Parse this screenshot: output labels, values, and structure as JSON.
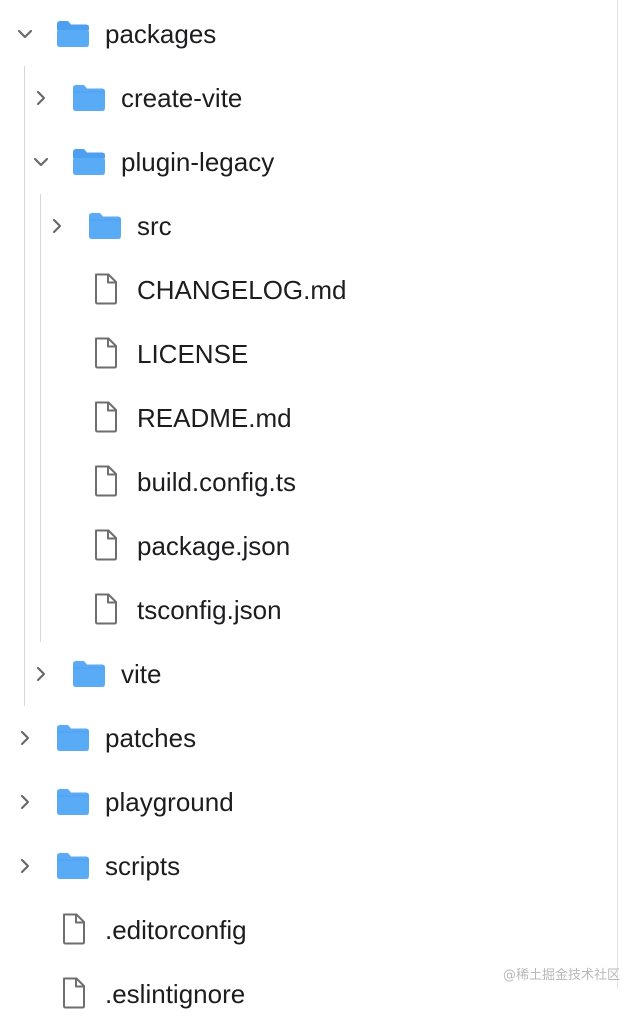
{
  "explorer": {
    "items": [
      {
        "label": "packages",
        "type": "folder",
        "expanded": true,
        "depth": 0
      },
      {
        "label": "create-vite",
        "type": "folder",
        "expanded": false,
        "depth": 1
      },
      {
        "label": "plugin-legacy",
        "type": "folder",
        "expanded": true,
        "depth": 1
      },
      {
        "label": "src",
        "type": "folder",
        "expanded": false,
        "depth": 2
      },
      {
        "label": "CHANGELOG.md",
        "type": "file",
        "depth": 2
      },
      {
        "label": "LICENSE",
        "type": "file",
        "depth": 2
      },
      {
        "label": "README.md",
        "type": "file",
        "depth": 2
      },
      {
        "label": "build.config.ts",
        "type": "file",
        "depth": 2
      },
      {
        "label": "package.json",
        "type": "file",
        "depth": 2
      },
      {
        "label": "tsconfig.json",
        "type": "file",
        "depth": 2
      },
      {
        "label": "vite",
        "type": "folder",
        "expanded": false,
        "depth": 1
      },
      {
        "label": "patches",
        "type": "folder",
        "expanded": false,
        "depth": 0
      },
      {
        "label": "playground",
        "type": "folder",
        "expanded": false,
        "depth": 0
      },
      {
        "label": "scripts",
        "type": "folder",
        "expanded": false,
        "depth": 0
      },
      {
        "label": ".editorconfig",
        "type": "file",
        "depth": 0
      },
      {
        "label": ".eslintignore",
        "type": "file",
        "depth": 0
      }
    ]
  },
  "watermark": "@稀土掘金技术社区",
  "colors": {
    "folder": "#5aabf5",
    "folder_tab": "#4d9ff0",
    "chevron": "#6b6b6b",
    "file_outline": "#6e6e6e",
    "guide": "#d6d6d6"
  },
  "icons": {
    "folder": "folder-icon",
    "file": "file-icon",
    "chevron_right": "chevron-right-icon",
    "chevron_down": "chevron-down-icon"
  }
}
